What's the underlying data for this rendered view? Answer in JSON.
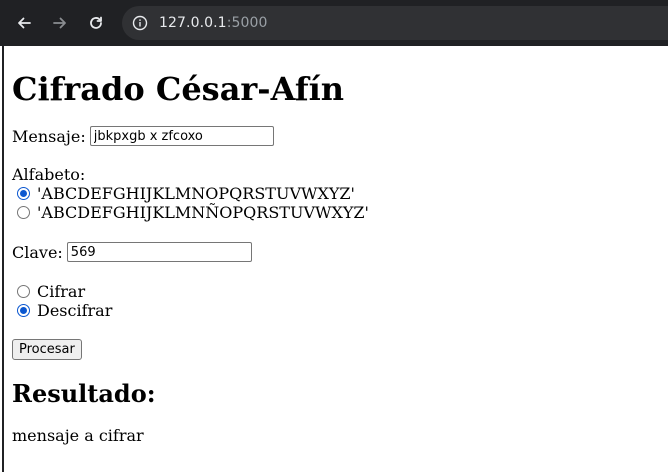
{
  "browser": {
    "url_host": "127.0.0.1",
    "url_port": ":5000"
  },
  "page": {
    "title": "Cifrado César-Afín",
    "message_label": "Mensaje:",
    "message_value": "jbkpxgb x zfcoxo",
    "alphabet_label": "Alfabeto:",
    "alphabet_options": [
      {
        "label": "'ABCDEFGHIJKLMNOPQRSTUVWXYZ'",
        "checked": true
      },
      {
        "label": "'ABCDEFGHIJKLMNÑOPQRSTUVWXYZ'",
        "checked": false
      }
    ],
    "key_label": "Clave:",
    "key_value": "569",
    "mode_options": [
      {
        "label": "Cifrar",
        "checked": false
      },
      {
        "label": "Descifrar",
        "checked": true
      }
    ],
    "submit_label": "Procesar",
    "result_heading": "Resultado:",
    "result_text": "mensaje a cifrar"
  },
  "colors": {
    "toolbar_bg": "#202124",
    "omnibox_bg": "#303134",
    "radio_accent": "#0b57d0"
  },
  "icons": [
    "back-arrow-icon",
    "forward-arrow-icon",
    "reload-icon",
    "info-icon"
  ]
}
